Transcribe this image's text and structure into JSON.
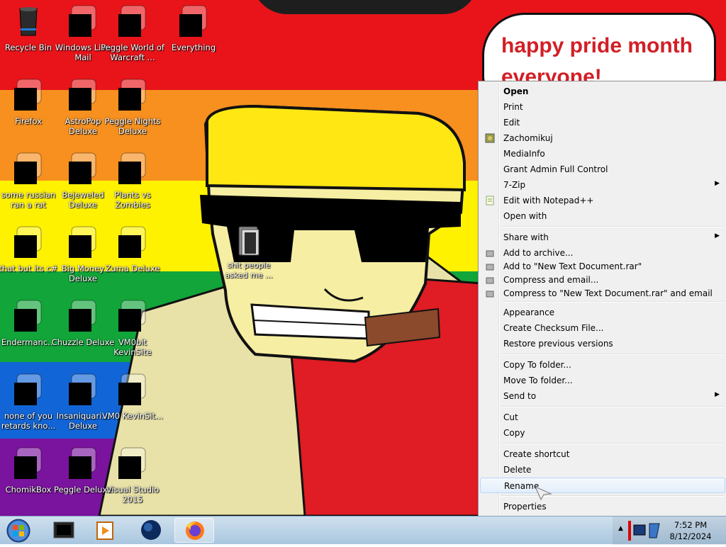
{
  "wallpaper": {
    "speech_text": "happy pride month everyone!",
    "stripe_colors": [
      "#e8141a",
      "#f7901e",
      "#fff200",
      "#12a53a",
      "#1265d6",
      "#7a139e"
    ]
  },
  "desktop_icons": [
    {
      "label": "Recycle Bin",
      "icon": "recycle-bin-icon"
    },
    {
      "label": "Windows Live Mail",
      "icon": "mail-icon"
    },
    {
      "label": "Peggle World of Warcraft ...",
      "icon": "peggle-icon"
    },
    {
      "label": "Everything",
      "icon": "search-app-icon"
    },
    {
      "label": "Firefox",
      "icon": "firefox-icon"
    },
    {
      "label": "AstroPop Deluxe",
      "icon": "astropop-icon"
    },
    {
      "label": "Peggle Nights Deluxe",
      "icon": "peggle-nights-icon"
    },
    {
      "label": "some russian ran a rat",
      "icon": "file-icon"
    },
    {
      "label": "Bejeweled Deluxe",
      "icon": "bejeweled-icon"
    },
    {
      "label": "Plants vs Zombies",
      "icon": "pvz-icon"
    },
    {
      "label": "that but its c#",
      "icon": "windows-stack-icon"
    },
    {
      "label": "Big Money Deluxe",
      "icon": "money-bag-icon"
    },
    {
      "label": "Zuma Deluxe",
      "icon": "zuma-icon"
    },
    {
      "label": "Endermanc...",
      "icon": "terminal-icon"
    },
    {
      "label": "Chuzzle Deluxe",
      "icon": "chuzzle-icon"
    },
    {
      "label": "VM0bit KevinSite",
      "icon": "vm-icon"
    },
    {
      "label": "none of you retards kno...",
      "icon": "program-icon"
    },
    {
      "label": "Insaniquari... Deluxe",
      "icon": "fish-icon"
    },
    {
      "label": "VM0 KevinSit...",
      "icon": "vm-icon"
    },
    {
      "label": "ChomikBox",
      "icon": "hamster-icon"
    },
    {
      "label": "Peggle Deluxe",
      "icon": "peggle-deluxe-icon"
    },
    {
      "label": "Visual Studio 2015",
      "icon": "visual-studio-icon"
    }
  ],
  "selected_file": {
    "label": "shit people asked me ...",
    "icon": "folder-icon"
  },
  "context_menu": {
    "items": [
      {
        "label": "Open",
        "bold": true
      },
      {
        "label": "Print"
      },
      {
        "label": "Edit"
      },
      {
        "label": "Zachomikuj",
        "icon": "chomikuj-icon"
      },
      {
        "label": "MediaInfo"
      },
      {
        "label": "Grant Admin Full Control"
      },
      {
        "label": "7-Zip",
        "submenu": true
      },
      {
        "label": "Edit with Notepad++",
        "icon": "notepad-plus-icon"
      },
      {
        "label": "Open with"
      },
      {
        "label": "Share with",
        "submenu": true
      },
      {
        "label": "Add to archive...",
        "icon": "winrar-icon"
      },
      {
        "label": "Add to \"New Text Document.rar\"",
        "icon": "winrar-icon"
      },
      {
        "label": "Compress and email...",
        "icon": "winrar-icon"
      },
      {
        "label": "Compress to \"New Text Document.rar\" and email",
        "icon": "winrar-icon"
      },
      {
        "label": "Appearance"
      },
      {
        "label": "Create Checksum File..."
      },
      {
        "label": "Restore previous versions"
      },
      {
        "label": "Copy To folder..."
      },
      {
        "label": "Move To folder..."
      },
      {
        "label": "Send to",
        "submenu": true
      },
      {
        "label": "Cut"
      },
      {
        "label": "Copy"
      },
      {
        "label": "Create shortcut"
      },
      {
        "label": "Delete"
      },
      {
        "label": "Rename",
        "highlighted": true
      },
      {
        "label": "Properties"
      }
    ]
  },
  "taskbar": {
    "start_icon": "windows-start-icon",
    "apps": [
      "terminal-icon",
      "media-player-icon",
      "globe-icon",
      "firefox-icon"
    ],
    "tray_icons": [
      "show-hidden-icon",
      "network-icon",
      "volume-icon"
    ],
    "clock_time": "7:52 PM",
    "clock_date": "8/12/2024"
  }
}
